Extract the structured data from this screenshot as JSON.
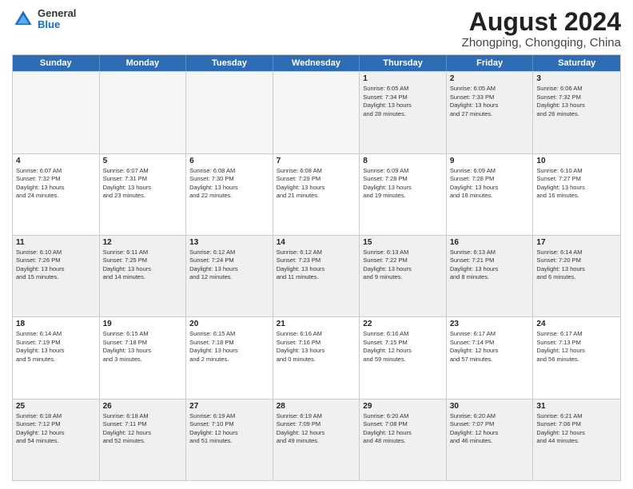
{
  "header": {
    "logo_general": "General",
    "logo_blue": "Blue",
    "title": "August 2024",
    "subtitle": "Zhongping, Chongqing, China"
  },
  "days_of_week": [
    "Sunday",
    "Monday",
    "Tuesday",
    "Wednesday",
    "Thursday",
    "Friday",
    "Saturday"
  ],
  "rows": [
    [
      {
        "day": "",
        "info": "",
        "empty": true
      },
      {
        "day": "",
        "info": "",
        "empty": true
      },
      {
        "day": "",
        "info": "",
        "empty": true
      },
      {
        "day": "",
        "info": "",
        "empty": true
      },
      {
        "day": "1",
        "info": "Sunrise: 6:05 AM\nSunset: 7:34 PM\nDaylight: 13 hours\nand 28 minutes."
      },
      {
        "day": "2",
        "info": "Sunrise: 6:05 AM\nSunset: 7:33 PM\nDaylight: 13 hours\nand 27 minutes."
      },
      {
        "day": "3",
        "info": "Sunrise: 6:06 AM\nSunset: 7:32 PM\nDaylight: 13 hours\nand 26 minutes."
      }
    ],
    [
      {
        "day": "4",
        "info": "Sunrise: 6:07 AM\nSunset: 7:32 PM\nDaylight: 13 hours\nand 24 minutes."
      },
      {
        "day": "5",
        "info": "Sunrise: 6:07 AM\nSunset: 7:31 PM\nDaylight: 13 hours\nand 23 minutes."
      },
      {
        "day": "6",
        "info": "Sunrise: 6:08 AM\nSunset: 7:30 PM\nDaylight: 13 hours\nand 22 minutes."
      },
      {
        "day": "7",
        "info": "Sunrise: 6:08 AM\nSunset: 7:29 PM\nDaylight: 13 hours\nand 21 minutes."
      },
      {
        "day": "8",
        "info": "Sunrise: 6:09 AM\nSunset: 7:28 PM\nDaylight: 13 hours\nand 19 minutes."
      },
      {
        "day": "9",
        "info": "Sunrise: 6:09 AM\nSunset: 7:28 PM\nDaylight: 13 hours\nand 18 minutes."
      },
      {
        "day": "10",
        "info": "Sunrise: 6:10 AM\nSunset: 7:27 PM\nDaylight: 13 hours\nand 16 minutes."
      }
    ],
    [
      {
        "day": "11",
        "info": "Sunrise: 6:10 AM\nSunset: 7:26 PM\nDaylight: 13 hours\nand 15 minutes."
      },
      {
        "day": "12",
        "info": "Sunrise: 6:11 AM\nSunset: 7:25 PM\nDaylight: 13 hours\nand 14 minutes."
      },
      {
        "day": "13",
        "info": "Sunrise: 6:12 AM\nSunset: 7:24 PM\nDaylight: 13 hours\nand 12 minutes."
      },
      {
        "day": "14",
        "info": "Sunrise: 6:12 AM\nSunset: 7:23 PM\nDaylight: 13 hours\nand 11 minutes."
      },
      {
        "day": "15",
        "info": "Sunrise: 6:13 AM\nSunset: 7:22 PM\nDaylight: 13 hours\nand 9 minutes."
      },
      {
        "day": "16",
        "info": "Sunrise: 6:13 AM\nSunset: 7:21 PM\nDaylight: 13 hours\nand 8 minutes."
      },
      {
        "day": "17",
        "info": "Sunrise: 6:14 AM\nSunset: 7:20 PM\nDaylight: 13 hours\nand 6 minutes."
      }
    ],
    [
      {
        "day": "18",
        "info": "Sunrise: 6:14 AM\nSunset: 7:19 PM\nDaylight: 13 hours\nand 5 minutes."
      },
      {
        "day": "19",
        "info": "Sunrise: 6:15 AM\nSunset: 7:18 PM\nDaylight: 13 hours\nand 3 minutes."
      },
      {
        "day": "20",
        "info": "Sunrise: 6:15 AM\nSunset: 7:18 PM\nDaylight: 13 hours\nand 2 minutes."
      },
      {
        "day": "21",
        "info": "Sunrise: 6:16 AM\nSunset: 7:16 PM\nDaylight: 13 hours\nand 0 minutes."
      },
      {
        "day": "22",
        "info": "Sunrise: 6:16 AM\nSunset: 7:15 PM\nDaylight: 12 hours\nand 59 minutes."
      },
      {
        "day": "23",
        "info": "Sunrise: 6:17 AM\nSunset: 7:14 PM\nDaylight: 12 hours\nand 57 minutes."
      },
      {
        "day": "24",
        "info": "Sunrise: 6:17 AM\nSunset: 7:13 PM\nDaylight: 12 hours\nand 56 minutes."
      }
    ],
    [
      {
        "day": "25",
        "info": "Sunrise: 6:18 AM\nSunset: 7:12 PM\nDaylight: 12 hours\nand 54 minutes."
      },
      {
        "day": "26",
        "info": "Sunrise: 6:18 AM\nSunset: 7:11 PM\nDaylight: 12 hours\nand 52 minutes."
      },
      {
        "day": "27",
        "info": "Sunrise: 6:19 AM\nSunset: 7:10 PM\nDaylight: 12 hours\nand 51 minutes."
      },
      {
        "day": "28",
        "info": "Sunrise: 6:19 AM\nSunset: 7:09 PM\nDaylight: 12 hours\nand 49 minutes."
      },
      {
        "day": "29",
        "info": "Sunrise: 6:20 AM\nSunset: 7:08 PM\nDaylight: 12 hours\nand 48 minutes."
      },
      {
        "day": "30",
        "info": "Sunrise: 6:20 AM\nSunset: 7:07 PM\nDaylight: 12 hours\nand 46 minutes."
      },
      {
        "day": "31",
        "info": "Sunrise: 6:21 AM\nSunset: 7:06 PM\nDaylight: 12 hours\nand 44 minutes."
      }
    ]
  ]
}
